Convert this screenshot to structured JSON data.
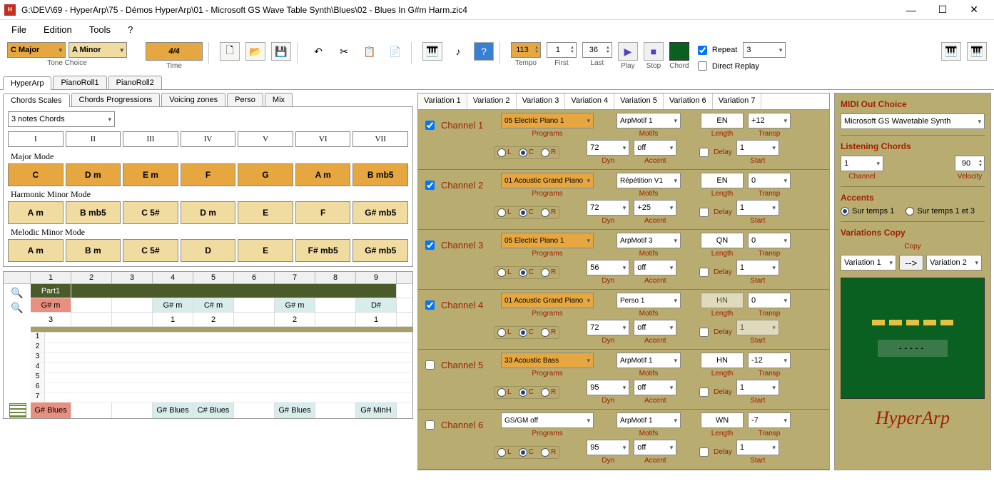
{
  "window": {
    "title": "G:\\DEV\\69 - HyperArp\\75 - Démos HyperArp\\01 - Microsoft GS Wave Table Synth\\Blues\\02 - Blues In G#m Harm.zic4"
  },
  "menu": {
    "file": "File",
    "edition": "Edition",
    "tools": "Tools",
    "help": "?"
  },
  "toolbar": {
    "tone1": "C Major",
    "tone2": "A Minor",
    "tone_label": "Tone Choice",
    "time": "4/4",
    "time_label": "Time",
    "tempo_val": "113",
    "tempo_label": "Tempo",
    "first_val": "1",
    "first_label": "First",
    "last_val": "36",
    "last_label": "Last",
    "play_label": "Play",
    "stop_label": "Stop",
    "chord_label": "Chord",
    "repeat": "Repeat",
    "repeat_val": "3",
    "direct_replay": "Direct Replay"
  },
  "main_tabs": {
    "t1": "HyperArp",
    "t2": "PianoRoll1",
    "t3": "PianoRoll2"
  },
  "sub_tabs": {
    "a": "Chords Scales",
    "b": "Chords Progressions",
    "c": "Voicing zones",
    "d": "Perso",
    "e": "Mix"
  },
  "chord_type": "3 notes Chords",
  "roman": [
    "I",
    "II",
    "III",
    "IV",
    "V",
    "VI",
    "VII"
  ],
  "modes": {
    "major": {
      "title": "Major Mode",
      "chords": [
        "C",
        "D m",
        "E m",
        "F",
        "G",
        "A m",
        "B mb5"
      ]
    },
    "harm": {
      "title": "Harmonic Minor Mode",
      "chords": [
        "A m",
        "B mb5",
        "C 5#",
        "D m",
        "E",
        "F",
        "G# mb5"
      ]
    },
    "mel": {
      "title": "Melodic Minor Mode",
      "chords": [
        "A m",
        "B m",
        "C 5#",
        "D",
        "E",
        "F# mb5",
        "G# mb5"
      ]
    }
  },
  "grid": {
    "cols": [
      "1",
      "2",
      "3",
      "4",
      "5",
      "6",
      "7",
      "8",
      "9"
    ],
    "part": "Part1",
    "chord_row": [
      "G# m",
      "",
      "",
      "G# m",
      "C# m",
      "",
      "G# m",
      "",
      "D#"
    ],
    "dur_row": [
      "3",
      "",
      "",
      "1",
      "2",
      "",
      "2",
      "",
      "1"
    ],
    "blues_row": [
      "G# Blues",
      "",
      "",
      "G# Blues",
      "C# Blues",
      "",
      "G# Blues",
      "",
      "G# MinH"
    ]
  },
  "var_tabs": [
    "Variation 1",
    "Variation 2",
    "Variation 3",
    "Variation 4",
    "Variation 5",
    "Variation 6",
    "Variation 7"
  ],
  "labels": {
    "programs": "Programs",
    "motifs": "Motifs",
    "length": "Length",
    "transp": "Transp",
    "dyn": "Dyn",
    "accent": "Accent",
    "delay": "Delay",
    "start": "Start",
    "L": "L",
    "C": "C",
    "R": "R"
  },
  "channels": [
    {
      "on": true,
      "name": "Channel 1",
      "program": "05 Electric Piano 1",
      "prog_orange": true,
      "motif": "ArpMotif 1",
      "length": "EN",
      "transp": "+12",
      "dyn": "72",
      "accent": "off",
      "delay": false,
      "start": "1",
      "dim_len": false
    },
    {
      "on": true,
      "name": "Channel 2",
      "program": "01 Acoustic Grand Piano",
      "prog_orange": true,
      "motif": "Répétition V1",
      "length": "EN",
      "transp": "0",
      "dyn": "72",
      "accent": "+25",
      "delay": false,
      "start": "1",
      "dim_len": false
    },
    {
      "on": true,
      "name": "Channel 3",
      "program": "05 Electric Piano 1",
      "prog_orange": true,
      "motif": "ArpMotif 3",
      "length": "QN",
      "transp": "0",
      "dyn": "56",
      "accent": "off",
      "delay": false,
      "start": "1",
      "dim_len": false
    },
    {
      "on": true,
      "name": "Channel 4",
      "program": "01 Acoustic Grand Piano",
      "prog_orange": true,
      "motif": "Perso 1",
      "length": "HN",
      "transp": "0",
      "dyn": "72",
      "accent": "off",
      "delay": false,
      "start": "1",
      "dim_len": true
    },
    {
      "on": false,
      "name": "Channel 5",
      "program": "33 Acoustic Bass",
      "prog_orange": true,
      "motif": "ArpMotif 1",
      "length": "HN",
      "transp": "-12",
      "dyn": "95",
      "accent": "off",
      "delay": false,
      "start": "1",
      "dim_len": false
    },
    {
      "on": false,
      "name": "Channel 6",
      "program": "GS/GM off",
      "prog_orange": false,
      "motif": "ArpMotif 1",
      "length": "WN",
      "transp": "-7",
      "dyn": "95",
      "accent": "off",
      "delay": false,
      "start": "1",
      "dim_len": false
    }
  ],
  "right": {
    "midi_title": "MIDI Out Choice",
    "midi_val": "Microsoft GS Wavetable Synth",
    "listen_title": "Listening Chords",
    "channel_val": "1",
    "channel_label": "Channel",
    "velocity_val": "90",
    "velocity_label": "Velocity",
    "accents_title": "Accents",
    "opt1": "Sur temps 1",
    "opt2": "Sur temps 1 et 3",
    "varcopy_title": "Variations Copy",
    "copy_label": "Copy",
    "copy_from": "Variation 1",
    "copy_to": "Variation 2",
    "arrow": "-->",
    "display_text": "-----",
    "logo": "HyperArp"
  }
}
